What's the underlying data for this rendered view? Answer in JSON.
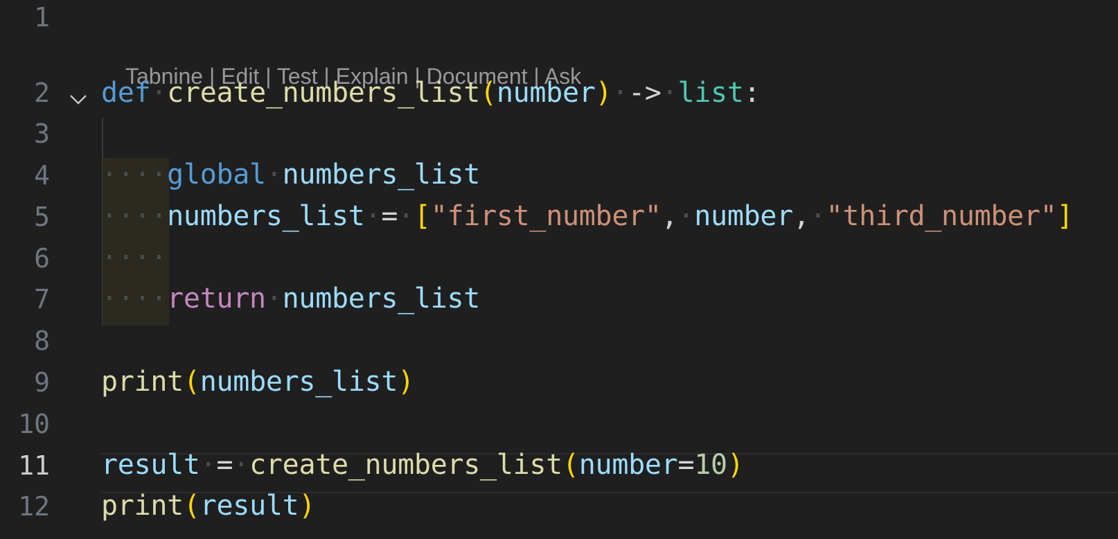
{
  "gutter": {
    "line_numbers": [
      "1",
      "2",
      "3",
      "4",
      "5",
      "6",
      "7",
      "8",
      "9",
      "10",
      "11",
      "12"
    ],
    "active_line": "11"
  },
  "codelens": {
    "items": [
      "Tabnine",
      "Edit",
      "Test",
      "Explain",
      "Document",
      "Ask"
    ],
    "separator": " | "
  },
  "code": {
    "line2": {
      "kw": "def",
      "fn": "create_numbers_list",
      "open": "(",
      "param": "number",
      "close": ")",
      "arrow": "->",
      "type": "list",
      "colon": ":"
    },
    "line4": {
      "kw": "global",
      "var": "numbers_list"
    },
    "line5": {
      "var": "numbers_list",
      "eq": "=",
      "open": "[",
      "s1": "\"first_number\"",
      "c1": ",",
      "v2": "number",
      "c2": ",",
      "s3": "\"third_number\"",
      "close": "]"
    },
    "line7": {
      "kw": "return",
      "var": "numbers_list"
    },
    "line9": {
      "fn": "print",
      "open": "(",
      "var": "numbers_list",
      "close": ")"
    },
    "line11": {
      "var": "result",
      "eq": "=",
      "fn": "create_numbers_list",
      "open": "(",
      "param": "number",
      "assign": "=",
      "num": "10",
      "close": ")"
    },
    "line12": {
      "fn": "print",
      "open": "(",
      "var": "result",
      "close": ")"
    }
  },
  "icons": {
    "fold": "chevron-down-icon"
  },
  "colors": {
    "background": "#1f1f1f",
    "keyword": "#569cd6",
    "control_keyword": "#c586c0",
    "function": "#dcdcaa",
    "variable": "#9cdcfe",
    "type": "#4ec9b0",
    "string": "#ce9178",
    "number": "#b5cea8",
    "bracket": "#ffd700"
  }
}
